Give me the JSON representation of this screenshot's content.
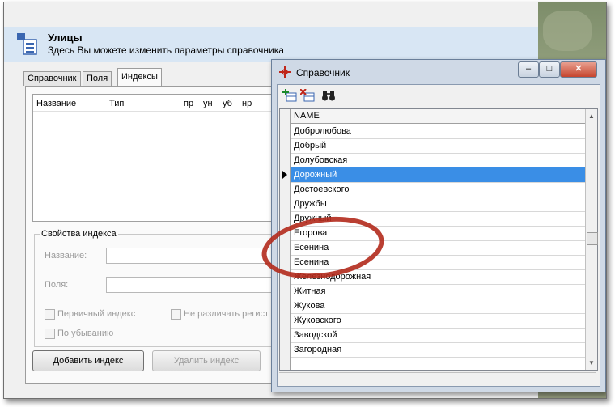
{
  "main_window": {
    "title": "Улицы",
    "subtitle": "Здесь Вы можете изменить параметры справочника",
    "tabs": [
      "Справочник",
      "Поля",
      "Индексы"
    ],
    "active_tab": "Индексы",
    "index_table_headers": [
      "Название",
      "Тип",
      "пр",
      "ун",
      "уб",
      "нр"
    ],
    "index_properties": {
      "group_title": "Свойства индекса",
      "name_label": "Название:",
      "fields_label": "Поля:",
      "primary_checkbox": "Первичный индекс",
      "case_checkbox": "Не различать регист",
      "desc_checkbox": "По убыванию"
    },
    "buttons": {
      "add_index": "Добавить индекс",
      "delete_index": "Удалить индекс"
    }
  },
  "dialog": {
    "title": "Справочник",
    "window_buttons": {
      "minimize": "–",
      "maximize": "□",
      "close": "✕"
    },
    "toolbar_icons": [
      "add-record-icon",
      "delete-record-icon",
      "binoculars-icon"
    ],
    "column_header": "NAME",
    "rows": [
      "Добролюбова",
      "Добрый",
      "Долубовская",
      "Дорожный",
      "Достоевского",
      "Дружбы",
      "Дружный",
      "Егорова",
      "Есенина",
      "Есенина",
      "Железнодорожная",
      "Житная",
      "Жукова",
      "Жуковского",
      "Заводской",
      "Загородная"
    ],
    "selected_row": "Дорожный"
  },
  "annotation": {
    "color": "#b32a1c"
  }
}
